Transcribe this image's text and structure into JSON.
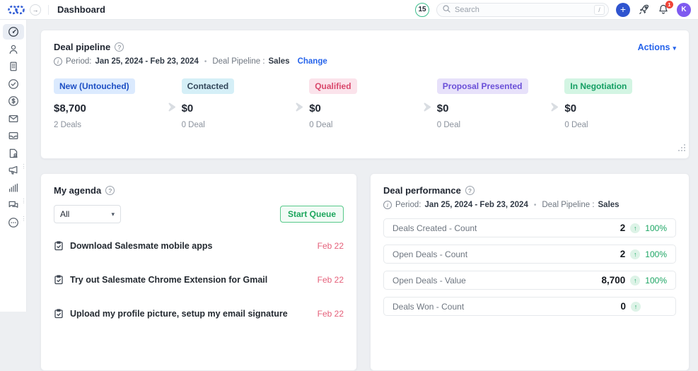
{
  "topbar": {
    "title": "Dashboard",
    "trial_days": "15",
    "search": {
      "placeholder": "Search",
      "shortcut_hint": "/"
    },
    "notification_count": "1",
    "avatar_initial": "K",
    "accent_blue": "#2f54cf",
    "avatar_color": "#7e5af0"
  },
  "sidebar": {
    "items": [
      {
        "name": "dashboard",
        "icon": "gauge-icon",
        "active": true
      },
      {
        "name": "contacts",
        "icon": "user-icon",
        "active": false
      },
      {
        "name": "companies",
        "icon": "building-icon",
        "active": false
      },
      {
        "name": "activities",
        "icon": "check-circle-icon",
        "active": false
      },
      {
        "name": "deals",
        "icon": "dollar-circle-icon",
        "active": false
      },
      {
        "name": "emails",
        "icon": "envelope-icon",
        "active": false
      },
      {
        "name": "inbox",
        "icon": "inbox-tray-icon",
        "active": false
      },
      {
        "name": "sequences",
        "icon": "document-person-icon",
        "active": false
      },
      {
        "name": "campaigns",
        "icon": "megaphone-icon",
        "active": false
      },
      {
        "name": "reports",
        "icon": "bar-chart-icon",
        "active": false
      },
      {
        "name": "chats",
        "icon": "chat-bubbles-icon",
        "active": false
      },
      {
        "name": "more-apps",
        "icon": "ellipsis-circle-icon",
        "active": false
      }
    ]
  },
  "deal_pipeline": {
    "title": "Deal pipeline",
    "period_label": "Period:",
    "period_value": "Jan 25, 2024 - Feb 23, 2024",
    "pipeline_label": "Deal Pipeline :",
    "pipeline_value": "Sales",
    "change_label": "Change",
    "actions_label": "Actions",
    "stages": [
      {
        "label": "New (Untouched)",
        "value": "$8,700",
        "deals": "2 Deals",
        "badge_bg": "#dbeafe",
        "badge_text": "#1d4fc4"
      },
      {
        "label": "Contacted",
        "value": "$0",
        "deals": "0 Deal",
        "badge_bg": "#d5eff7",
        "badge_text": "#33475b"
      },
      {
        "label": "Qualified",
        "value": "$0",
        "deals": "0 Deal",
        "badge_bg": "#fbe3eb",
        "badge_text": "#d9486c"
      },
      {
        "label": "Proposal Presented",
        "value": "$0",
        "deals": "0 Deal",
        "badge_bg": "#e7e1fa",
        "badge_text": "#6a4fd8"
      },
      {
        "label": "In Negotiation",
        "value": "$0",
        "deals": "0 Deal",
        "badge_bg": "#d3f5e3",
        "badge_text": "#149e63"
      }
    ]
  },
  "my_agenda": {
    "title": "My agenda",
    "filter_value": "All",
    "start_queue_label": "Start Queue",
    "date_color": "#e5607a",
    "tasks": [
      {
        "title": "Download Salesmate mobile apps",
        "date": "Feb 22"
      },
      {
        "title": "Try out Salesmate Chrome Extension for Gmail",
        "date": "Feb 22"
      },
      {
        "title": "Upload my profile picture, setup my email signature",
        "date": "Feb 22"
      }
    ]
  },
  "deal_performance": {
    "title": "Deal performance",
    "period_label": "Period:",
    "period_value": "Jan 25, 2024 - Feb 23, 2024",
    "pipeline_label": "Deal Pipeline :",
    "pipeline_value": "Sales",
    "positive_color": "#1da664",
    "metrics": [
      {
        "label": "Deals Created - Count",
        "value": "2",
        "change": "100%"
      },
      {
        "label": "Open Deals - Count",
        "value": "2",
        "change": "100%"
      },
      {
        "label": "Open Deals - Value",
        "value": "8,700",
        "change": "100%"
      },
      {
        "label": "Deals Won - Count",
        "value": "0",
        "change": ""
      }
    ]
  }
}
